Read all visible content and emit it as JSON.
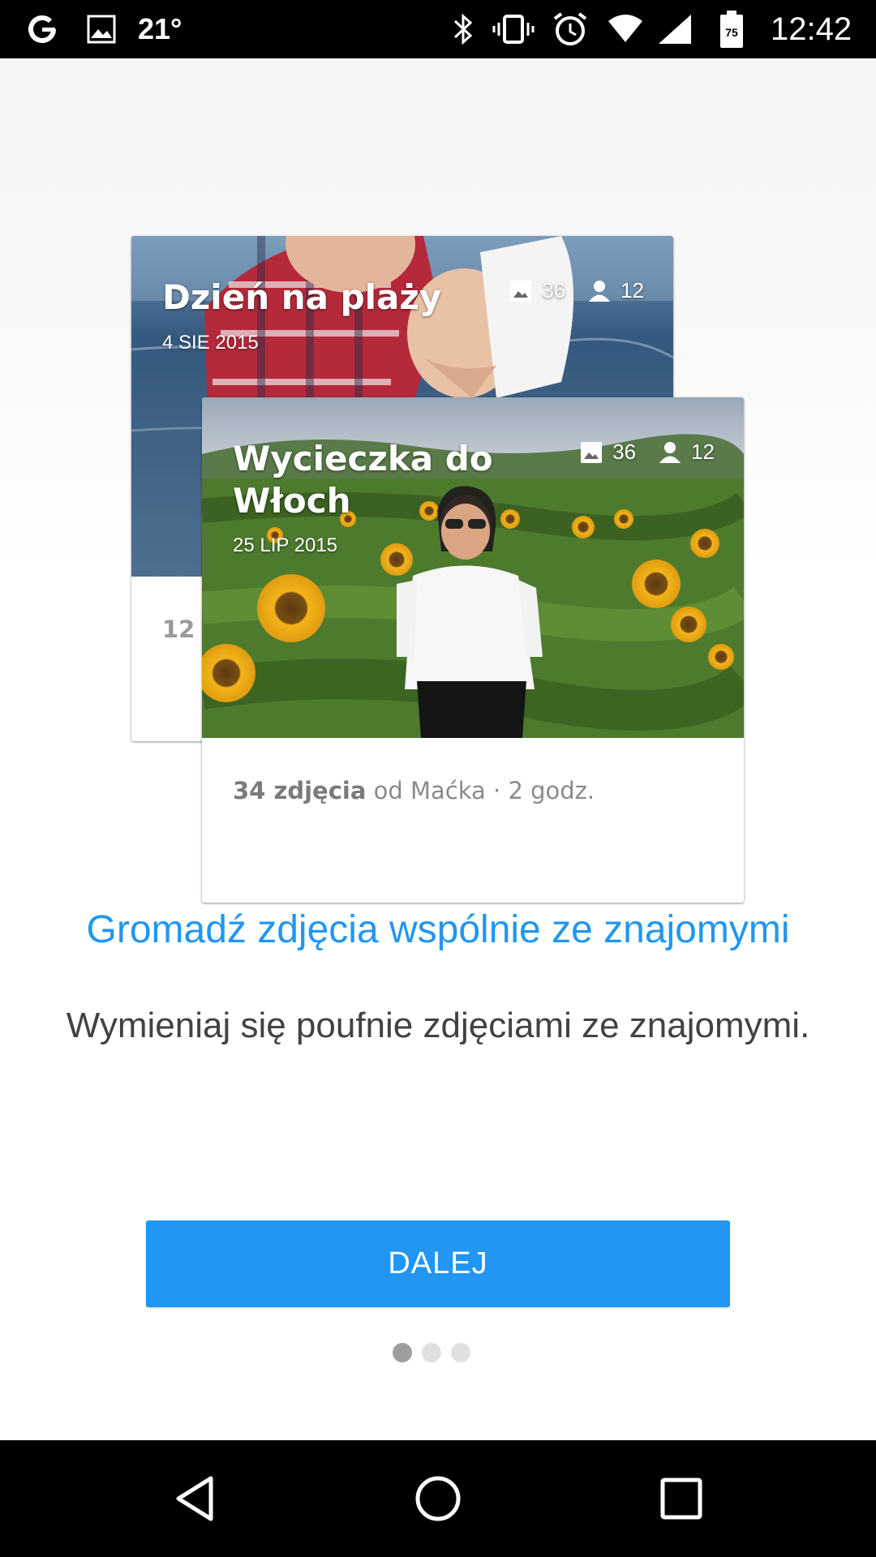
{
  "status_bar": {
    "temperature": "21°",
    "battery_level": "75",
    "time": "12:42",
    "icons": [
      "google-icon",
      "image-icon",
      "bluetooth-icon",
      "vibrate-icon",
      "alarm-icon",
      "wifi-icon",
      "signal-icon",
      "battery-icon"
    ]
  },
  "cards": {
    "back": {
      "title": "Dzień na plaży",
      "date": "4 SIE 2015",
      "photos_count": "36",
      "people_count": "12",
      "footer": "12"
    },
    "front": {
      "title": "Wycieczka do Włoch",
      "date": "25 LIP 2015",
      "photos_count": "36",
      "people_count": "12",
      "footer_bold": "34 zdjęcia",
      "footer_rest": " od Maćka · 2 godz."
    }
  },
  "headline": "Gromadź zdjęcia wspólnie ze znajomymi",
  "subline": "Wymieniaj się poufnie zdjęciami ze znajomymi.",
  "next_button": "DALEJ",
  "pager": {
    "total": 3,
    "active": 1
  },
  "colors": {
    "accent": "#2196f3",
    "status_bar": "#000000"
  },
  "nav_bar": {
    "icons": [
      "back-icon",
      "home-icon",
      "recents-icon"
    ]
  }
}
